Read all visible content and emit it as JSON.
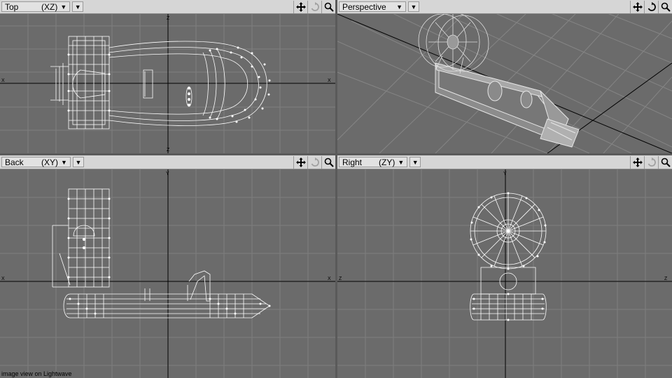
{
  "viewports": {
    "top": {
      "view": "Top",
      "axes": "(XZ)"
    },
    "persp": {
      "view": "Perspective"
    },
    "back": {
      "view": "Back",
      "axes": "(XY)"
    },
    "right": {
      "view": "Right",
      "axes": "(ZY)"
    }
  },
  "axis_labels": {
    "x": "X",
    "y": "Y",
    "z": "Z"
  },
  "caption": "image view on Lightwave",
  "colors": {
    "grid_bg": "#6b6b6b",
    "grid_line": "#7f7f7f",
    "axis_line": "#000000",
    "wireframe": "#ffffff",
    "header_bg": "#d6d6d6"
  }
}
